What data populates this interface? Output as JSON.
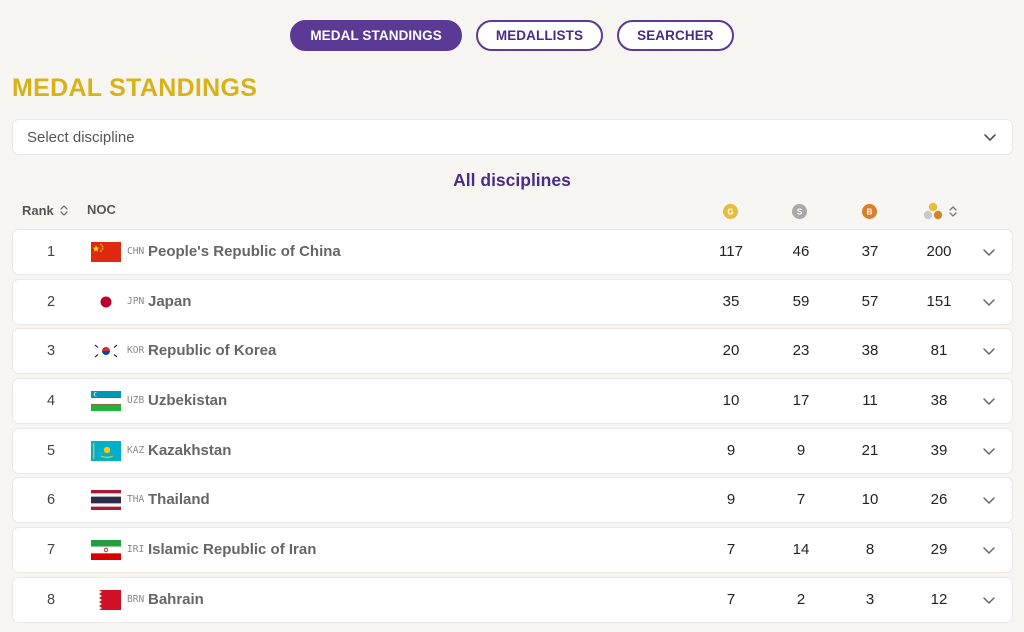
{
  "tabs": [
    {
      "label": "MEDAL STANDINGS",
      "active": true
    },
    {
      "label": "MEDALLISTS",
      "active": false
    },
    {
      "label": "SEARCHER",
      "active": false
    }
  ],
  "title": "MEDAL STANDINGS",
  "discipline_select": {
    "label": "Select discipline"
  },
  "subtitle": "All disciplines",
  "table_header": {
    "rank": "Rank",
    "noc": "NOC"
  },
  "colors": {
    "accent": "#5b3a96",
    "title": "#d8b21b",
    "gold": "#e8bc3c",
    "silver": "#a9a9a9",
    "bronze": "#d38330"
  },
  "rows": [
    {
      "rank": "1",
      "code": "CHN",
      "country": "People's Republic of China",
      "gold": "117",
      "silver": "46",
      "bronze": "37",
      "total": "200",
      "flag": "china-flag-icon"
    },
    {
      "rank": "2",
      "code": "JPN",
      "country": "Japan",
      "gold": "35",
      "silver": "59",
      "bronze": "57",
      "total": "151",
      "flag": "japan-flag-icon"
    },
    {
      "rank": "3",
      "code": "KOR",
      "country": "Republic of Korea",
      "gold": "20",
      "silver": "23",
      "bronze": "38",
      "total": "81",
      "flag": "korea-flag-icon"
    },
    {
      "rank": "4",
      "code": "UZB",
      "country": "Uzbekistan",
      "gold": "10",
      "silver": "17",
      "bronze": "11",
      "total": "38",
      "flag": "uzbekistan-flag-icon"
    },
    {
      "rank": "5",
      "code": "KAZ",
      "country": "Kazakhstan",
      "gold": "9",
      "silver": "9",
      "bronze": "21",
      "total": "39",
      "flag": "kazakhstan-flag-icon"
    },
    {
      "rank": "6",
      "code": "THA",
      "country": "Thailand",
      "gold": "9",
      "silver": "7",
      "bronze": "10",
      "total": "26",
      "flag": "thailand-flag-icon"
    },
    {
      "rank": "7",
      "code": "IRI",
      "country": "Islamic Republic of Iran",
      "gold": "7",
      "silver": "14",
      "bronze": "8",
      "total": "29",
      "flag": "iran-flag-icon"
    },
    {
      "rank": "8",
      "code": "BRN",
      "country": "Bahrain",
      "gold": "7",
      "silver": "2",
      "bronze": "3",
      "total": "12",
      "flag": "bahrain-flag-icon"
    }
  ]
}
